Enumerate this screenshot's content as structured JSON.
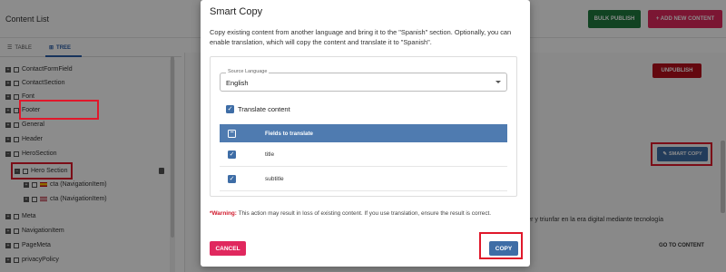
{
  "app": {
    "title": "Content List",
    "bulk_publish_label": "BULK PUBLISH",
    "add_new_label": "+ ADD NEW CONTENT",
    "view_tabs": [
      {
        "label": "TABLE",
        "icon": "table-icon",
        "active": false
      },
      {
        "label": "TREE",
        "icon": "tree-icon",
        "active": true
      }
    ],
    "tree_items": [
      {
        "label": "ContactFormField"
      },
      {
        "label": "ContactSection"
      },
      {
        "label": "Font"
      },
      {
        "label": "Footer"
      },
      {
        "label": "General"
      },
      {
        "label": "Header"
      },
      {
        "label": "HeroSection"
      },
      {
        "label": "Hero Section",
        "selected": true
      },
      {
        "label": "cta (NavigationItem)",
        "flag": "es"
      },
      {
        "label": "cta (NavigationItem)",
        "flag": "us"
      },
      {
        "label": "Meta"
      },
      {
        "label": "NavigationItem"
      },
      {
        "label": "PageMeta"
      },
      {
        "label": "privacyPolicy"
      }
    ],
    "unpublish_label": "UNPUBLISH",
    "smart_copy_label": "SMART COPY",
    "bg_input_text": "crecer y triunfar en la era digital mediante tecnología",
    "go_to_content_label": "GO TO CONTENT",
    "colors": {
      "bulk": "#1f7a3e",
      "add": "#e0285e",
      "unpublish": "#b60f1c",
      "primary": "#3e6da6",
      "highlight": "#e0182b"
    }
  },
  "dialog": {
    "title": "Smart Copy",
    "description": "Copy existing content from another language and bring it to the \"Spanish\" section. Optionally, you can enable translation, which will copy the content and translate it to \"Spanish\".",
    "source_language": {
      "legend": "Source Language",
      "value": "English"
    },
    "translate": {
      "label": "Translate content",
      "checked": true
    },
    "table": {
      "header": "Fields to translate",
      "rows": [
        {
          "label": "title",
          "checked": true
        },
        {
          "label": "subtitle",
          "checked": true
        }
      ]
    },
    "warning_prefix": "*Warning:",
    "warning_text": " This action may result in loss of existing content. If you use translation, ensure the result is correct.",
    "cancel_label": "CANCEL",
    "copy_label": "COPY"
  }
}
